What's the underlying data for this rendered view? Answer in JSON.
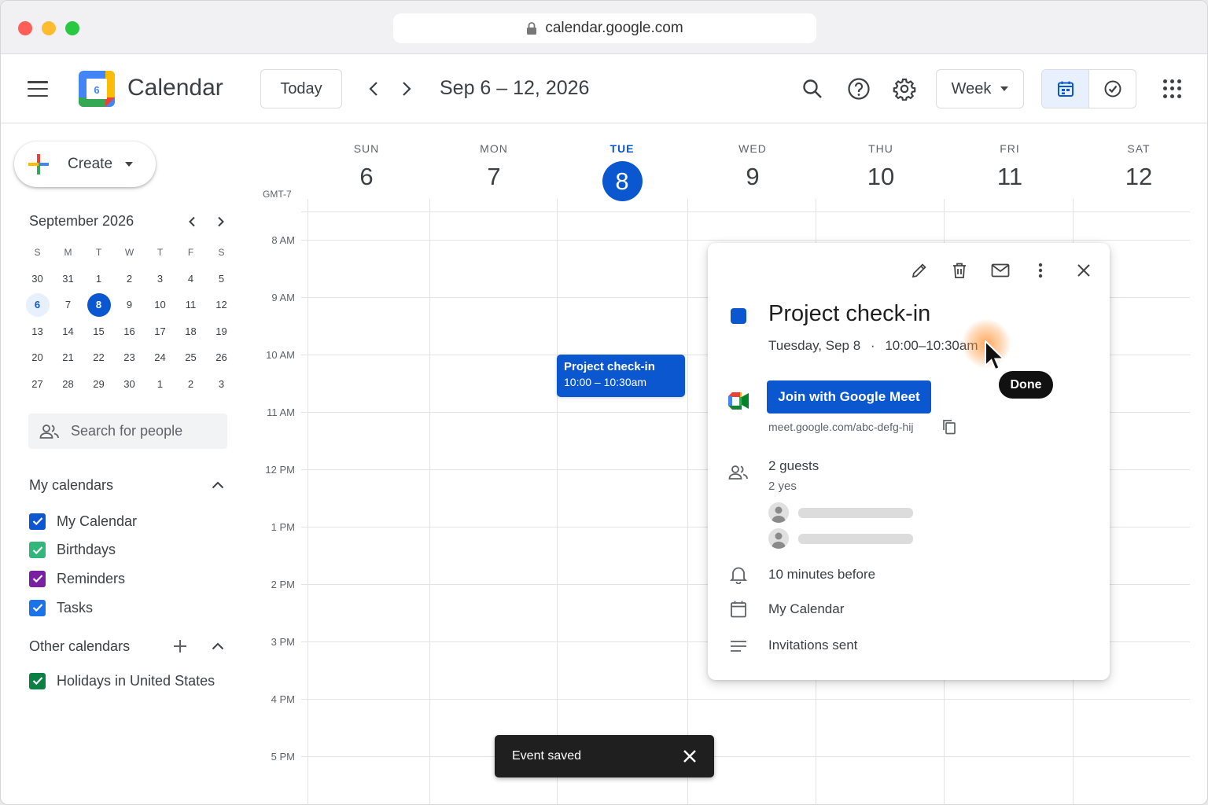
{
  "browser": {
    "url": "calendar.google.com"
  },
  "header": {
    "app_title": "Calendar",
    "today_label": "Today",
    "date_range": "Sep 6 – 12, 2026",
    "view_select": "Week",
    "accent_color": "#0b57d0"
  },
  "sidebar": {
    "create_label": "Create",
    "mini_calendar": {
      "title": "September 2026",
      "weekday_headers": [
        "S",
        "M",
        "T",
        "W",
        "T",
        "F",
        "S"
      ],
      "weeks": [
        [
          "30",
          "31",
          "1",
          "2",
          "3",
          "4",
          "5"
        ],
        [
          "6",
          "7",
          "8",
          "9",
          "10",
          "11",
          "12"
        ],
        [
          "13",
          "14",
          "15",
          "16",
          "17",
          "18",
          "19"
        ],
        [
          "20",
          "21",
          "22",
          "23",
          "24",
          "25",
          "26"
        ],
        [
          "27",
          "28",
          "29",
          "30",
          "1",
          "2",
          "3"
        ]
      ],
      "today": "8",
      "selected": "6"
    },
    "people_search_placeholder": "Search for people",
    "my_calendars_title": "My calendars",
    "my_calendars": [
      {
        "label": "My Calendar",
        "color": "#0b57d0"
      },
      {
        "label": "Birthdays",
        "color": "#33b679"
      },
      {
        "label": "Reminders",
        "color": "#7b1fa2"
      },
      {
        "label": "Tasks",
        "color": "#1a73e8"
      }
    ],
    "other_calendars_title": "Other calendars",
    "other_calendars": [
      {
        "label": "Holidays in United States",
        "color": "#0b8043"
      }
    ]
  },
  "week": {
    "timezone": "GMT-7",
    "days": [
      {
        "dow": "SUN",
        "num": "6"
      },
      {
        "dow": "MON",
        "num": "7"
      },
      {
        "dow": "TUE",
        "num": "8",
        "today": true
      },
      {
        "dow": "WED",
        "num": "9"
      },
      {
        "dow": "THU",
        "num": "10"
      },
      {
        "dow": "FRI",
        "num": "11"
      },
      {
        "dow": "SAT",
        "num": "12"
      }
    ],
    "hours": [
      "8 AM",
      "9 AM",
      "10 AM",
      "11 AM",
      "12 PM",
      "1 PM",
      "2 PM",
      "3 PM",
      "4 PM",
      "5 PM"
    ]
  },
  "event": {
    "title": "Project check-in",
    "time": "10:00 – 10:30am"
  },
  "popover": {
    "title": "Project check-in",
    "date": "Tuesday, Sep 8",
    "separator": "·",
    "time": "10:00–10:30am",
    "join_label": "Join with Google Meet",
    "meet_link": "meet.google.com/abc-defg-hij",
    "guests_title": "2 guests",
    "guests_sub": "2 yes",
    "reminder": "10 minutes before",
    "calendar": "My Calendar",
    "invitations": "Invitations sent"
  },
  "cursor_tooltip": "Done",
  "snackbar": {
    "message": "Event saved"
  }
}
